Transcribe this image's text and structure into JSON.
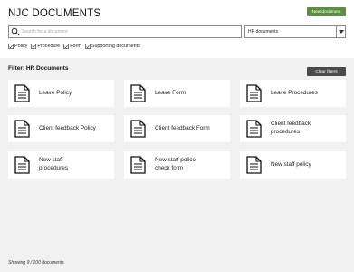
{
  "header": {
    "title": "NJC DOCUMENTS",
    "new_document_label": "New document"
  },
  "search": {
    "placeholder": "Search for a document"
  },
  "type_select": {
    "value": "HR documents"
  },
  "filters": [
    {
      "label": "Policy",
      "checked": true
    },
    {
      "label": "Procedure",
      "checked": true
    },
    {
      "label": "Form",
      "checked": true
    },
    {
      "label": "Supporting documents",
      "checked": true
    }
  ],
  "filter_title": "Filter: HR Documents",
  "clear_filters_label": "Clear filters",
  "documents": [
    {
      "label": "Leave Policy"
    },
    {
      "label": "Leave Form"
    },
    {
      "label": "Leave Procedures"
    },
    {
      "label": "Client feedback Policy"
    },
    {
      "label": "Client feedback Form"
    },
    {
      "label": "Client feedback procedures"
    },
    {
      "label": "New staff procedures"
    },
    {
      "label": "New staff police check form"
    },
    {
      "label": "New staff policy"
    }
  ],
  "footer": {
    "count_text": "Showing 9 / 100 documents"
  },
  "colors": {
    "accent_green": "#5c8d45",
    "dark_button": "#4a4a4a",
    "page_background": "#f1f1f1"
  }
}
